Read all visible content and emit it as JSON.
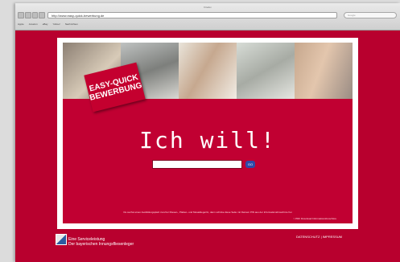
{
  "window": {
    "title": "Firefox"
  },
  "browser": {
    "url": "http://www.easy-quick-bewerbung.de",
    "search_placeholder": "Google",
    "bookmarks": [
      "Apple",
      "Amazon",
      "eBay",
      "Yahoo!",
      "Nachrichten"
    ]
  },
  "page": {
    "logo_line1": "EASY-QUICK",
    "logo_line2": "BEWERBUNG",
    "headline": "Ich will!",
    "search_value": "",
    "go_label": "GO",
    "info_text": "Du suchst einen Ausbildungsplatz zum/zur Fliesen-, Platten- und Mosaikleger/in, dann schicke diese Seite mit Deinem PIN aus der Informationsbroschüre frei",
    "pdf_link": "> PDF Download Informationsbroschüre"
  },
  "footer": {
    "line1": "Eine Serviceleistung",
    "line2": "Der bayerischen Innungsfliesenleger",
    "links": "DATENSCHUTZ | IMPRESSUM"
  },
  "colors": {
    "brand_red": "#c10032",
    "go_blue": "#2e4aa8"
  }
}
